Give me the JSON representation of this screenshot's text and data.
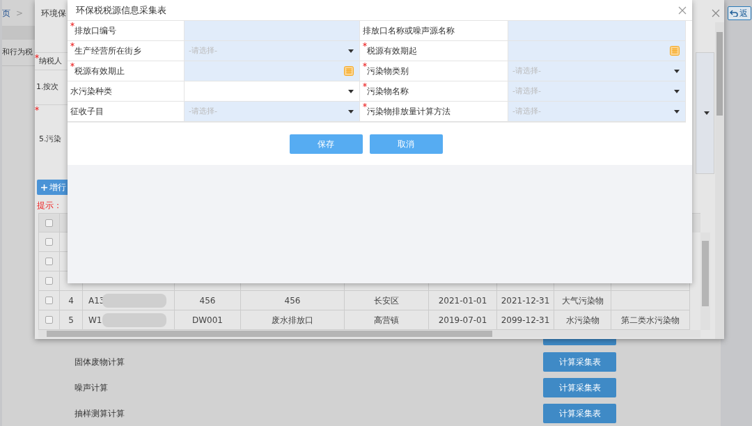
{
  "background_page": {
    "breadcrumb": [
      "页",
      ">"
    ],
    "back_button": "返",
    "side_label": "和行为税",
    "calc_rows": [
      {
        "kind": "covered"
      },
      {
        "kind": "row",
        "label": "固体废物计算",
        "button": "计算采集表"
      },
      {
        "kind": "row",
        "label": "噪声计算",
        "button": "计算采集表"
      },
      {
        "kind": "row",
        "label": "抽样测算计算",
        "button": "计算采集表"
      }
    ]
  },
  "list_window": {
    "title": "环境保",
    "labels": [
      {
        "text": "纳税人",
        "required": true
      },
      {
        "text": "1.按次",
        "required": false
      },
      {
        "text": "5.污染",
        "required": true
      }
    ],
    "add_row_button": "增行",
    "tip": "提示：",
    "table": {
      "header_checked": false,
      "rows": [
        {
          "checked": false
        },
        {
          "checked": false
        },
        {
          "checked": false
        },
        {
          "checked": false,
          "no": "4",
          "code": "A13",
          "code_redacted": true,
          "outlet_code": "456",
          "outlet_name": "456",
          "town": "长安区",
          "valid_from": "2021-01-01",
          "valid_to": "2021-12-31",
          "category": "大气污染物"
        },
        {
          "checked": false,
          "no": "5",
          "code": "W1",
          "code_redacted": true,
          "outlet_code": "DW001",
          "outlet_name": "废水排放口",
          "town": "高营镇",
          "valid_from": "2019-07-01",
          "valid_to": "2099-12-31",
          "category": "水污染物",
          "pollutant": "第二类水污染物"
        }
      ]
    }
  },
  "dialog": {
    "title": "环保税税源信息采集表",
    "fields": [
      {
        "label": "排放口编号",
        "required": true,
        "kind": "text",
        "enabled": true
      },
      {
        "label": "排放口名称或噪声源名称",
        "required": false,
        "kind": "text",
        "enabled": true
      },
      {
        "label": "生产经营所在街乡",
        "required": true,
        "kind": "select",
        "placeholder": "-请选择-",
        "enabled": true
      },
      {
        "label": "税源有效期起",
        "required": true,
        "kind": "date",
        "enabled": true
      },
      {
        "label": "税源有效期止",
        "required": true,
        "kind": "date",
        "enabled": true
      },
      {
        "label": "污染物类别",
        "required": true,
        "kind": "select",
        "placeholder": "-请选择-",
        "enabled": true
      },
      {
        "label": "水污染种类",
        "required": false,
        "kind": "select",
        "enabled": false
      },
      {
        "label": "污染物名称",
        "required": true,
        "kind": "select",
        "placeholder": "-请选择-",
        "enabled": true
      },
      {
        "label": "征收子目",
        "required": false,
        "kind": "select",
        "placeholder": "-请选择-",
        "enabled": true
      },
      {
        "label": "污染物排放量计算方法",
        "required": true,
        "kind": "select",
        "placeholder": "-请选择-",
        "enabled": true
      }
    ],
    "buttons": [
      "保存",
      "取消"
    ]
  }
}
